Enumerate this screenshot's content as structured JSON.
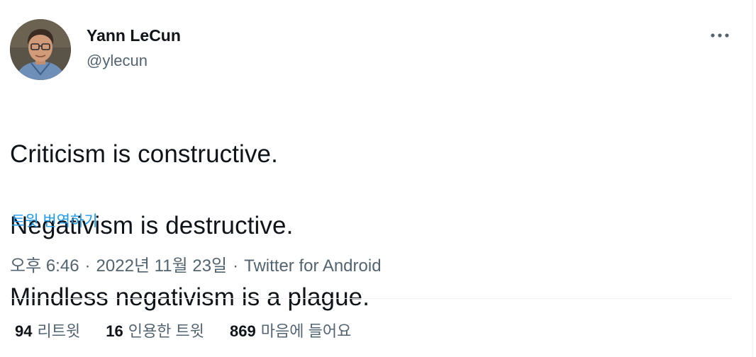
{
  "author": {
    "display_name": "Yann LeCun",
    "handle": "@ylecun",
    "avatar_icon": "profile-photo"
  },
  "more_icon": "more-dots-icon",
  "tweet": {
    "lines": [
      "Criticism is constructive.",
      "Negativism is destructive.",
      "Mindless negativism is a plague."
    ],
    "translate_label": "트윗 번역하기"
  },
  "meta": {
    "time": "오후 6:46",
    "separator": "·",
    "date": "2022년 11월 23일",
    "source": "Twitter for Android"
  },
  "stats": {
    "retweets": {
      "count": "94",
      "label": "리트윗"
    },
    "quotes": {
      "count": "16",
      "label": "인용한 트윗"
    },
    "likes": {
      "count": "869",
      "label": "마음에 들어요"
    }
  },
  "colors": {
    "text_primary": "#0f1419",
    "text_secondary": "#536471",
    "link": "#1d9bf0",
    "border": "#eff3f4"
  }
}
